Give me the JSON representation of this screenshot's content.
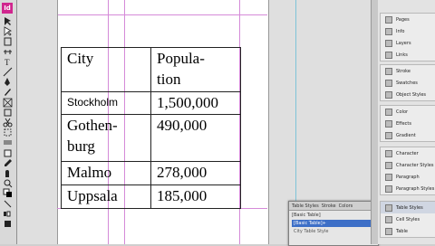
{
  "app": {
    "logo_text": "Id"
  },
  "tools": [
    "selection-tool-icon",
    "direct-selection-tool-icon",
    "page-tool-icon",
    "gap-tool-icon",
    "type-tool-icon",
    "line-tool-icon",
    "pen-tool-icon",
    "pencil-tool-icon",
    "rectangle-frame-tool-icon",
    "rectangle-tool-icon",
    "scissors-tool-icon",
    "free-transform-tool-icon",
    "gradient-tool-icon",
    "note-tool-icon",
    "eyedropper-tool-icon",
    "hand-tool-icon",
    "zoom-tool-icon",
    "fill-stroke-icon",
    "swap-icon",
    "apply-color-icon",
    "view-mode-icon"
  ],
  "table": {
    "rows": [
      [
        "City",
        "Popula-\ntion"
      ],
      [
        "Stockholm",
        "1,500,000"
      ],
      [
        "Gothen-\nburg",
        "490,000"
      ],
      [
        "Malmo",
        "278,000"
      ],
      [
        "Uppsala",
        "185,000"
      ]
    ]
  },
  "popup": {
    "tabs": [
      "Table Styles",
      "Stroke",
      "Colors"
    ],
    "base": "[Basic Table]",
    "selected": "[Basic Table]+",
    "item": "City Table Style"
  },
  "panels": {
    "group1": [
      "Pages",
      "Info",
      "Layers",
      "Links"
    ],
    "group2": [
      "Stroke",
      "Swatches",
      "Object Styles"
    ],
    "group3": [
      "Color",
      "Effects",
      "Gradient"
    ],
    "group4": [
      "Character",
      "Character Styles",
      "Paragraph",
      "Paragraph Styles"
    ],
    "group5": [
      "Table Styles",
      "Cell Styles",
      "Table"
    ]
  },
  "colors": {
    "accent": "#3d6fc7",
    "logo": "#d0268e",
    "guide_magenta": "#d58ad8",
    "guide_cyan": "#7ec3d8"
  }
}
